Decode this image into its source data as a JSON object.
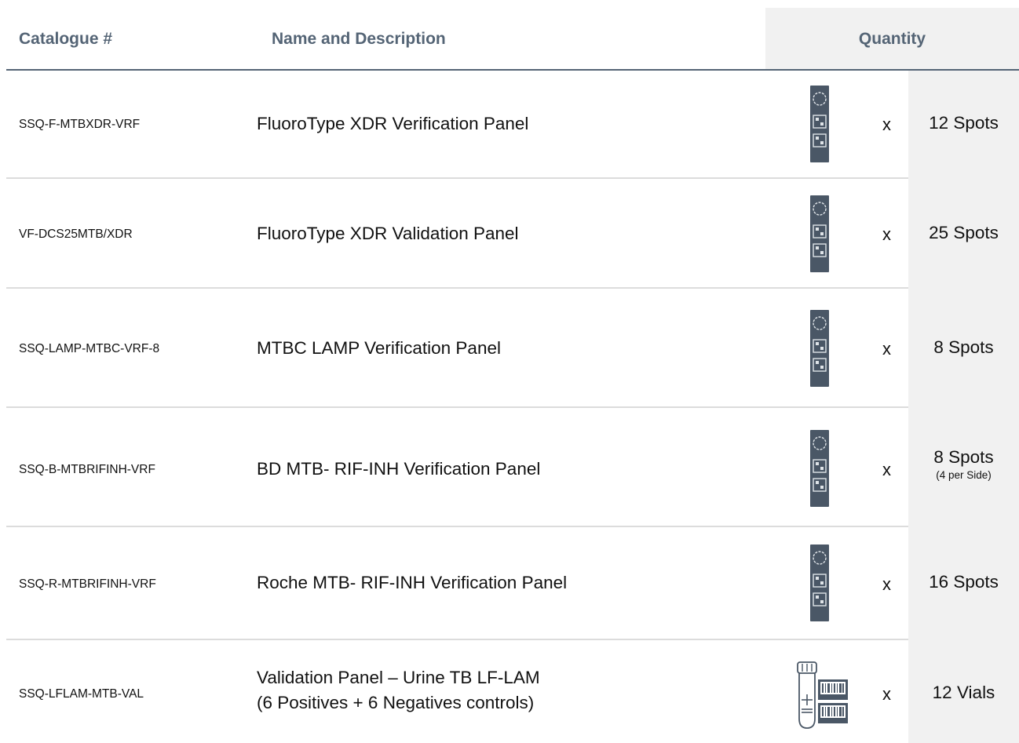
{
  "header": {
    "catalogue": "Catalogue #",
    "name": "Name and Description",
    "quantity": "Quantity"
  },
  "colors": {
    "header_text": "#546475",
    "header_rule": "#546475",
    "row_rule": "#dcdcdc",
    "quantity_column_bg": "#f1f1f1",
    "icon_fill": "#4a5766"
  },
  "rows": [
    {
      "catalogue": "SSQ-F-MTBXDR-VRF",
      "name": "FluoroType XDR Verification Panel",
      "icon": "qr-slide-icon",
      "x": "x",
      "quantity": "12 Spots"
    },
    {
      "catalogue": "VF-DCS25MTB/XDR",
      "name": "FluoroType XDR Validation Panel",
      "icon": "qr-slide-icon",
      "x": "x",
      "quantity": "25 Spots"
    },
    {
      "catalogue": "SSQ-LAMP-MTBC-VRF-8",
      "name": "MTBC LAMP Verification Panel",
      "icon": "qr-slide-icon",
      "x": "x",
      "quantity": "8 Spots"
    },
    {
      "catalogue": "SSQ-B-MTBRIFINH-VRF",
      "name": "BD MTB- RIF-INH Verification Panel",
      "icon": "qr-slide-icon",
      "x": "x",
      "quantity": "8 Spots",
      "quantity_note": "(4 per Side)"
    },
    {
      "catalogue": "SSQ-R-MTBRIFINH-VRF",
      "name": "Roche MTB- RIF-INH Verification Panel",
      "icon": "qr-slide-icon",
      "x": "x",
      "quantity": "16 Spots"
    },
    {
      "catalogue": "SSQ-LFLAM-MTB-VAL",
      "name": "Validation Panel – Urine TB LF-LAM",
      "name_line2": "(6 Positives + 6 Negatives controls)",
      "icon": "vial-barcode-icon",
      "x": "x",
      "quantity": "12 Vials"
    }
  ]
}
